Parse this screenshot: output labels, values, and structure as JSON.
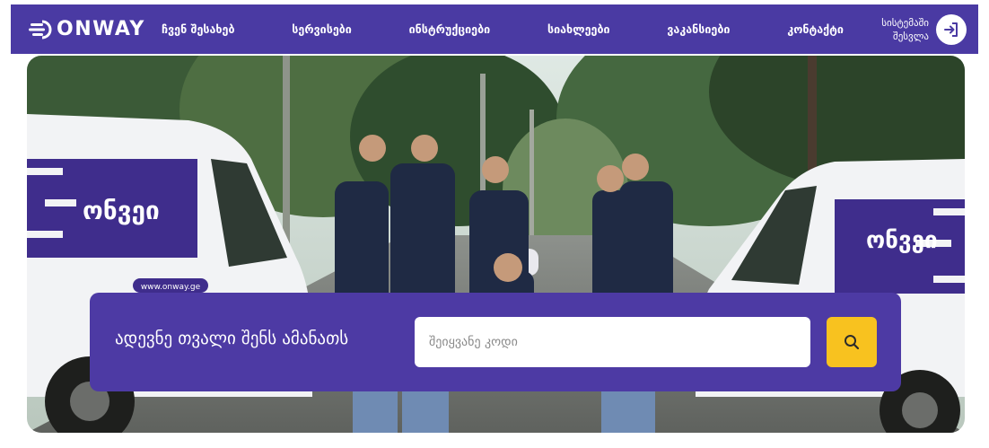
{
  "header": {
    "logo_text": "ONWAY",
    "nav": [
      {
        "label": "ჩვენ შესახებ"
      },
      {
        "label": "სერვისები"
      },
      {
        "label": "ინსტრუქციები"
      },
      {
        "label": "სიახლეები"
      },
      {
        "label": "ვაკანსიები"
      },
      {
        "label": "კონტაქტი"
      }
    ],
    "login_line1": "სისტემაში",
    "login_line2": "შესვლა"
  },
  "hero": {
    "van_brand": "ონვეი",
    "van_website": "www.onway.ge"
  },
  "tracking": {
    "title": "ადევნე თვალი შენს ამანათს",
    "placeholder": "შეიყვანე კოდი",
    "search_icon": "search-icon"
  },
  "colors": {
    "brand_purple": "#4a3aa3",
    "accent_yellow": "#f8c21f",
    "white": "#ffffff"
  }
}
